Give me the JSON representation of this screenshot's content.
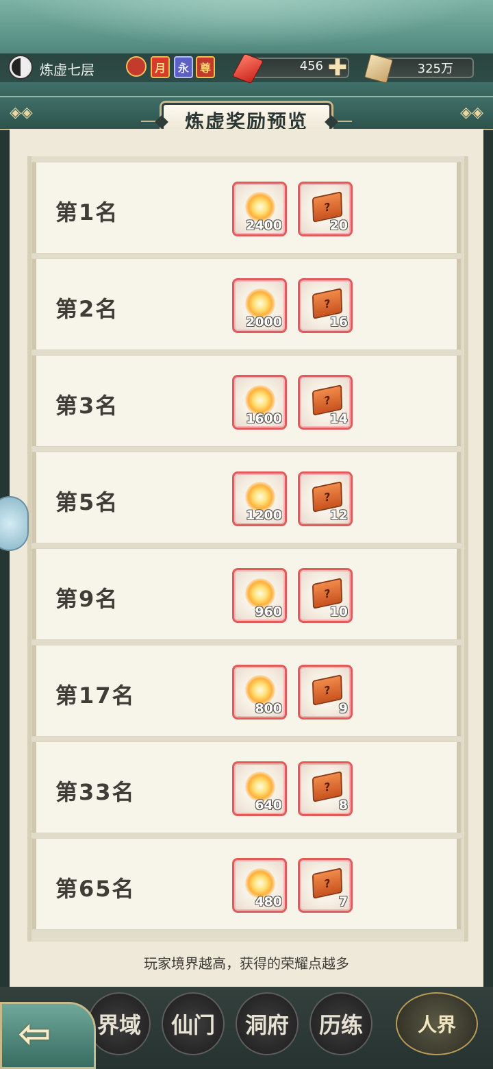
{
  "header": {
    "realm_label": "炼虚七层",
    "badges": [
      "",
      "月",
      "永",
      "尊"
    ],
    "resource_gem_value": "456",
    "resource_scroll_value": "325万"
  },
  "panel": {
    "title": "炼虚奖励预览",
    "rows": [
      {
        "rank": "第1名",
        "glory_points": "2400",
        "box_count": "20"
      },
      {
        "rank": "第2名",
        "glory_points": "2000",
        "box_count": "16"
      },
      {
        "rank": "第3名",
        "glory_points": "1600",
        "box_count": "14"
      },
      {
        "rank": "第5名",
        "glory_points": "1200",
        "box_count": "12"
      },
      {
        "rank": "第9名",
        "glory_points": "960",
        "box_count": "10"
      },
      {
        "rank": "第17名",
        "glory_points": "800",
        "box_count": "9"
      },
      {
        "rank": "第33名",
        "glory_points": "640",
        "box_count": "8"
      },
      {
        "rank": "第65名",
        "glory_points": "480",
        "box_count": "7"
      }
    ],
    "footer_note": "玩家境界越高，获得的荣耀点越多"
  },
  "bottom_nav": {
    "items": [
      "界域",
      "仙门",
      "洞府",
      "历练",
      "人界"
    ]
  },
  "colors": {
    "item_border": "#e25b5b",
    "title_dark": "#2b3734",
    "panel_bg": "#efe9da"
  }
}
